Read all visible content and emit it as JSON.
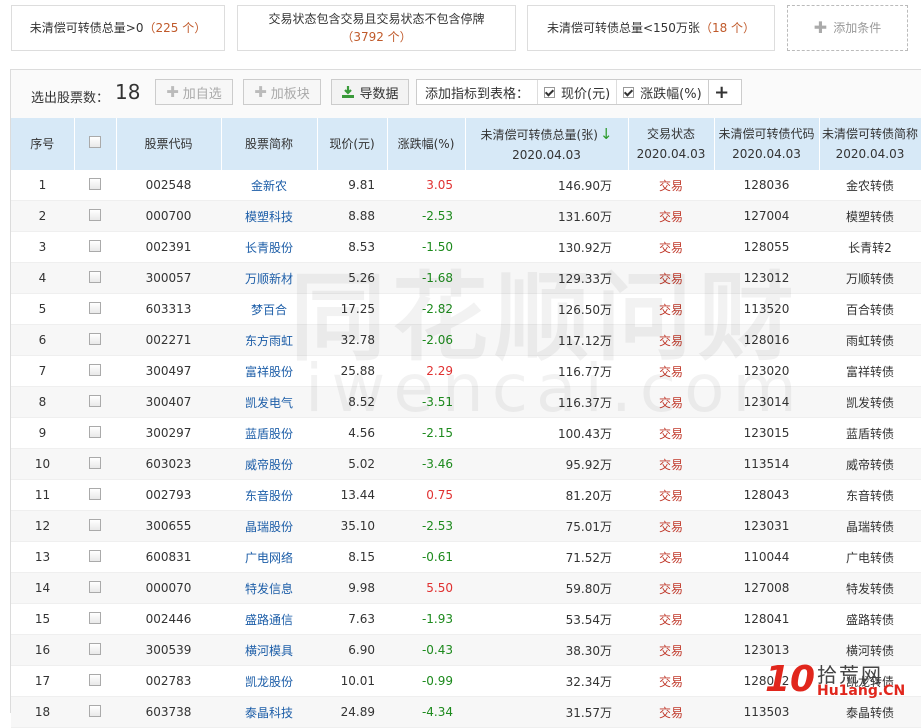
{
  "conditions": [
    {
      "text": "未清偿可转债总量>0",
      "count": "（225 个）"
    },
    {
      "text": "交易状态包含交易且交易状态不包含停牌",
      "count": "（3792 个）"
    },
    {
      "text": "未清偿可转债总量<150万张",
      "count": "（18 个）"
    }
  ],
  "add_condition_label": "添加条件",
  "toolbar": {
    "selected_label": "选出股票数：",
    "selected_count": "18",
    "add_watch_label": "加自选",
    "add_block_label": "加板块",
    "export_label": "导数据",
    "metric_label": "添加指标到表格：",
    "metric_price_label": "现价(元)",
    "metric_change_label": "涨跌幅(%)",
    "metric_add_label": "+"
  },
  "table": {
    "headers": {
      "idx": "序号",
      "code": "股票代码",
      "name": "股票简称",
      "price": "现价(元)",
      "change": "涨跌幅(%)",
      "total": "未清偿可转债总量(张)",
      "total_date": "2020.04.03",
      "status": "交易状态",
      "status_date": "2020.04.03",
      "bond_code": "未清偿可转债代码",
      "bond_code_date": "2020.04.03",
      "bond_name": "未清偿可转债简称",
      "bond_name_date": "2020.04.03"
    },
    "rows": [
      {
        "idx": "1",
        "code": "002548",
        "name": "金新农",
        "price": "9.81",
        "change": "3.05",
        "dir": "up",
        "total": "146.90万",
        "status": "交易",
        "bond_code": "128036",
        "bond_name": "金农转债"
      },
      {
        "idx": "2",
        "code": "000700",
        "name": "模塑科技",
        "price": "8.88",
        "change": "-2.53",
        "dir": "down",
        "total": "131.60万",
        "status": "交易",
        "bond_code": "127004",
        "bond_name": "模塑转债"
      },
      {
        "idx": "3",
        "code": "002391",
        "name": "长青股份",
        "price": "8.53",
        "change": "-1.50",
        "dir": "down",
        "total": "130.92万",
        "status": "交易",
        "bond_code": "128055",
        "bond_name": "长青转2"
      },
      {
        "idx": "4",
        "code": "300057",
        "name": "万顺新材",
        "price": "5.26",
        "change": "-1.68",
        "dir": "down",
        "total": "129.33万",
        "status": "交易",
        "bond_code": "123012",
        "bond_name": "万顺转债"
      },
      {
        "idx": "5",
        "code": "603313",
        "name": "梦百合",
        "price": "17.25",
        "change": "-2.82",
        "dir": "down",
        "total": "126.50万",
        "status": "交易",
        "bond_code": "113520",
        "bond_name": "百合转债"
      },
      {
        "idx": "6",
        "code": "002271",
        "name": "东方雨虹",
        "price": "32.78",
        "change": "-2.06",
        "dir": "down",
        "total": "117.12万",
        "status": "交易",
        "bond_code": "128016",
        "bond_name": "雨虹转债"
      },
      {
        "idx": "7",
        "code": "300497",
        "name": "富祥股份",
        "price": "25.88",
        "change": "2.29",
        "dir": "up",
        "total": "116.77万",
        "status": "交易",
        "bond_code": "123020",
        "bond_name": "富祥转债"
      },
      {
        "idx": "8",
        "code": "300407",
        "name": "凯发电气",
        "price": "8.52",
        "change": "-3.51",
        "dir": "down",
        "total": "116.37万",
        "status": "交易",
        "bond_code": "123014",
        "bond_name": "凯发转债"
      },
      {
        "idx": "9",
        "code": "300297",
        "name": "蓝盾股份",
        "price": "4.56",
        "change": "-2.15",
        "dir": "down",
        "total": "100.43万",
        "status": "交易",
        "bond_code": "123015",
        "bond_name": "蓝盾转债"
      },
      {
        "idx": "10",
        "code": "603023",
        "name": "威帝股份",
        "price": "5.02",
        "change": "-3.46",
        "dir": "down",
        "total": "95.92万",
        "status": "交易",
        "bond_code": "113514",
        "bond_name": "威帝转债"
      },
      {
        "idx": "11",
        "code": "002793",
        "name": "东音股份",
        "price": "13.44",
        "change": "0.75",
        "dir": "up",
        "total": "81.20万",
        "status": "交易",
        "bond_code": "128043",
        "bond_name": "东音转债"
      },
      {
        "idx": "12",
        "code": "300655",
        "name": "晶瑞股份",
        "price": "35.10",
        "change": "-2.53",
        "dir": "down",
        "total": "75.01万",
        "status": "交易",
        "bond_code": "123031",
        "bond_name": "晶瑞转债"
      },
      {
        "idx": "13",
        "code": "600831",
        "name": "广电网络",
        "price": "8.15",
        "change": "-0.61",
        "dir": "down",
        "total": "71.52万",
        "status": "交易",
        "bond_code": "110044",
        "bond_name": "广电转债"
      },
      {
        "idx": "14",
        "code": "000070",
        "name": "特发信息",
        "price": "9.98",
        "change": "5.50",
        "dir": "up",
        "total": "59.80万",
        "status": "交易",
        "bond_code": "127008",
        "bond_name": "特发转债"
      },
      {
        "idx": "15",
        "code": "002446",
        "name": "盛路通信",
        "price": "7.63",
        "change": "-1.93",
        "dir": "down",
        "total": "53.54万",
        "status": "交易",
        "bond_code": "128041",
        "bond_name": "盛路转债"
      },
      {
        "idx": "16",
        "code": "300539",
        "name": "横河模具",
        "price": "6.90",
        "change": "-0.43",
        "dir": "down",
        "total": "38.30万",
        "status": "交易",
        "bond_code": "123013",
        "bond_name": "横河转债"
      },
      {
        "idx": "17",
        "code": "002783",
        "name": "凯龙股份",
        "price": "10.01",
        "change": "-0.99",
        "dir": "down",
        "total": "32.34万",
        "status": "交易",
        "bond_code": "128052",
        "bond_name": "凯龙转债"
      },
      {
        "idx": "18",
        "code": "603738",
        "name": "泰晶科技",
        "price": "24.89",
        "change": "-4.34",
        "dir": "down",
        "total": "31.57万",
        "status": "交易",
        "bond_code": "113503",
        "bond_name": "泰晶转债"
      }
    ]
  },
  "watermark": {
    "cn": "同花顺问财",
    "en": "iwencai.com"
  },
  "site_logo": {
    "num": "10",
    "cn": "拾荒网",
    "en": "Hu1ang.CN"
  },
  "colors": {
    "header_bg": "#d7e9f7",
    "up": "#e03131",
    "down": "#1d8a1d",
    "link": "#1d5ea8",
    "status": "#c0392b"
  }
}
